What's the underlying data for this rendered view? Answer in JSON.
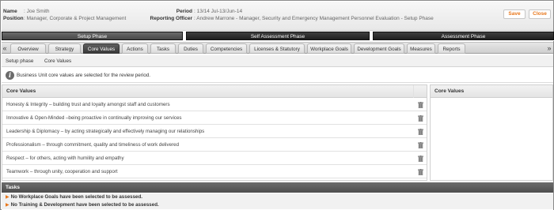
{
  "header": {
    "name_label": "Name",
    "name_value": ": Joe Smith",
    "position_label": "Position",
    "position_value": ": Manager, Corporate & Project Management",
    "period_label": "Period",
    "period_value": ": 13/14 Jul-13/Jun-14",
    "officer_label": "Reporting Officer",
    "officer_value": ": Andrew Marrone - Manager, Security and Emergency Management Personnel Evaluation - Setup Phase",
    "save_label": "Save",
    "close_label": "Close"
  },
  "phases": [
    {
      "label": "Setup Phase",
      "active": true
    },
    {
      "label": "Self Assessment Phase",
      "active": false
    },
    {
      "label": "Assessment Phase",
      "active": false
    }
  ],
  "tabs": [
    {
      "label": "Overview"
    },
    {
      "label": "Strategy"
    },
    {
      "label": "Core Values",
      "active": true
    },
    {
      "label": "Actions"
    },
    {
      "label": "Tasks"
    },
    {
      "label": "Duties"
    },
    {
      "label": "Competencies"
    },
    {
      "label": "Licenses & Statutory"
    },
    {
      "label": "Workplace Goals"
    },
    {
      "label": "Development Goals"
    },
    {
      "label": "Measures"
    },
    {
      "label": "Reports"
    }
  ],
  "scroll": {
    "left": "«",
    "right": "»"
  },
  "breadcrumb": {
    "item1": "Setup phase",
    "item2": "Core Values"
  },
  "info": {
    "icon": "i",
    "text": "Business Unit core values are selected for the review period."
  },
  "core_values_panel": {
    "title": "Core Values",
    "rows": [
      "Honesty & Integrity – building trust and loyalty amongst staff and customers",
      "Innovative & Open-Minded –being proactive in continually improving our services",
      "Leadership & Diplomacy – by acting strategically and effectively managing our relationships",
      "Professionalism – through commitment, quality and timeliness of work delivered",
      "Respect – for others, acting with humility and empathy",
      "Teamwork – through unity, cooperation and support"
    ]
  },
  "right_panel": {
    "title": "Core Values"
  },
  "tasks": {
    "title": "Tasks",
    "items": [
      "No Workplace Goals have been selected to be assessed.",
      "No Training & Development have been selected to be assessed."
    ]
  },
  "colors": {
    "accent": "#e8761a",
    "dark_bar": "#2b2b2b"
  }
}
